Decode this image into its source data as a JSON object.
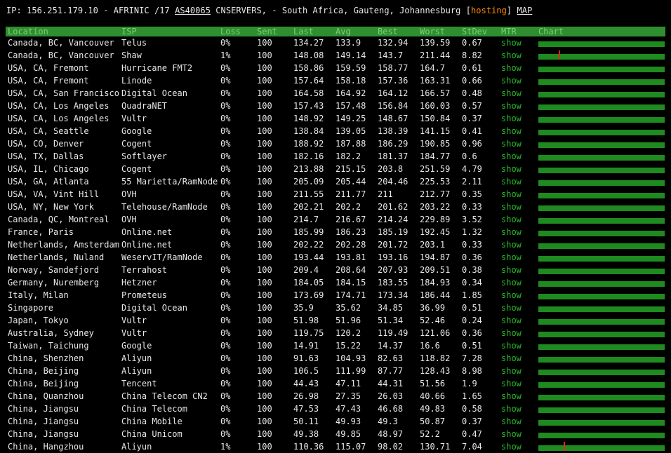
{
  "header": {
    "ip_prefix": "IP: 156.251.179.10 - AFRINIC /17 ",
    "asn": "AS40065",
    "location_text": " CNSERVERS, - South Africa, Gauteng, Johannesburg [",
    "hosting": "hosting",
    "close_bracket": "] ",
    "map": "MAP"
  },
  "columns": {
    "location": "Location",
    "isp": "ISP",
    "loss": "Loss",
    "sent": "Sent",
    "last": "Last",
    "avg": "Avg",
    "best": "Best",
    "worst": "Worst",
    "stdev": "StDev",
    "mtr": "MTR",
    "chart": "Chart"
  },
  "colors": {
    "header_bar": "#2f8f2f",
    "chart_fill": "#1f8a1f",
    "spike": "#ff2020",
    "link": "#2db82d",
    "hosting": "#ff8c00"
  },
  "rows": [
    {
      "location": "Canada, BC, Vancouver",
      "isp": "Telus",
      "loss": "0%",
      "sent": "100",
      "last": "134.27",
      "avg": "133.9",
      "best": "132.94",
      "worst": "139.59",
      "stdev": "0.67",
      "mtr": "show"
    },
    {
      "location": "Canada, BC, Vancouver",
      "isp": "Shaw",
      "loss": "1%",
      "sent": "100",
      "last": "148.08",
      "avg": "149.14",
      "best": "143.7",
      "worst": "211.44",
      "stdev": "8.82",
      "mtr": "show",
      "spike": 0.16
    },
    {
      "location": "USA, CA, Fremont",
      "isp": "Hurricane FMT2",
      "loss": "0%",
      "sent": "100",
      "last": "158.86",
      "avg": "159.59",
      "best": "158.77",
      "worst": "164.7",
      "stdev": "0.61",
      "mtr": "show"
    },
    {
      "location": "USA, CA, Fremont",
      "isp": "Linode",
      "loss": "0%",
      "sent": "100",
      "last": "157.64",
      "avg": "158.18",
      "best": "157.36",
      "worst": "163.31",
      "stdev": "0.66",
      "mtr": "show"
    },
    {
      "location": "USA, CA, San Francisco",
      "isp": "Digital Ocean",
      "loss": "0%",
      "sent": "100",
      "last": "164.58",
      "avg": "164.92",
      "best": "164.12",
      "worst": "166.57",
      "stdev": "0.48",
      "mtr": "show"
    },
    {
      "location": "USA, CA, Los Angeles",
      "isp": "QuadraNET",
      "loss": "0%",
      "sent": "100",
      "last": "157.43",
      "avg": "157.48",
      "best": "156.84",
      "worst": "160.03",
      "stdev": "0.57",
      "mtr": "show"
    },
    {
      "location": "USA, CA, Los Angeles",
      "isp": "Vultr",
      "loss": "0%",
      "sent": "100",
      "last": "148.92",
      "avg": "149.25",
      "best": "148.67",
      "worst": "150.84",
      "stdev": "0.37",
      "mtr": "show"
    },
    {
      "location": "USA, CA, Seattle",
      "isp": "Google",
      "loss": "0%",
      "sent": "100",
      "last": "138.84",
      "avg": "139.05",
      "best": "138.39",
      "worst": "141.15",
      "stdev": "0.41",
      "mtr": "show"
    },
    {
      "location": "USA, CO, Denver",
      "isp": "Cogent",
      "loss": "0%",
      "sent": "100",
      "last": "188.92",
      "avg": "187.88",
      "best": "186.29",
      "worst": "190.85",
      "stdev": "0.96",
      "mtr": "show"
    },
    {
      "location": "USA, TX, Dallas",
      "isp": "Softlayer",
      "loss": "0%",
      "sent": "100",
      "last": "182.16",
      "avg": "182.2",
      "best": "181.37",
      "worst": "184.77",
      "stdev": "0.6",
      "mtr": "show"
    },
    {
      "location": "USA, IL, Chicago",
      "isp": "Cogent",
      "loss": "0%",
      "sent": "100",
      "last": "213.88",
      "avg": "215.15",
      "best": "203.8",
      "worst": "251.59",
      "stdev": "4.79",
      "mtr": "show"
    },
    {
      "location": "USA, GA, Atlanta",
      "isp": "55 Marietta/RamNode",
      "loss": "0%",
      "sent": "100",
      "last": "205.09",
      "avg": "205.44",
      "best": "204.46",
      "worst": "225.53",
      "stdev": "2.11",
      "mtr": "show"
    },
    {
      "location": "USA, VA, Vint Hill",
      "isp": "OVH",
      "loss": "0%",
      "sent": "100",
      "last": "211.55",
      "avg": "211.77",
      "best": "211",
      "worst": "212.77",
      "stdev": "0.35",
      "mtr": "show"
    },
    {
      "location": "USA, NY, New York",
      "isp": "Telehouse/RamNode",
      "loss": "0%",
      "sent": "100",
      "last": "202.21",
      "avg": "202.2",
      "best": "201.62",
      "worst": "203.22",
      "stdev": "0.33",
      "mtr": "show"
    },
    {
      "location": "Canada, QC, Montreal",
      "isp": "OVH",
      "loss": "0%",
      "sent": "100",
      "last": "214.7",
      "avg": "216.67",
      "best": "214.24",
      "worst": "229.89",
      "stdev": "3.52",
      "mtr": "show"
    },
    {
      "location": "France, Paris",
      "isp": "Online.net",
      "loss": "0%",
      "sent": "100",
      "last": "185.99",
      "avg": "186.23",
      "best": "185.19",
      "worst": "192.45",
      "stdev": "1.32",
      "mtr": "show"
    },
    {
      "location": "Netherlands, Amsterdam",
      "isp": "Online.net",
      "loss": "0%",
      "sent": "100",
      "last": "202.22",
      "avg": "202.28",
      "best": "201.72",
      "worst": "203.1",
      "stdev": "0.33",
      "mtr": "show"
    },
    {
      "location": "Netherlands, Nuland",
      "isp": "WeservIT/RamNode",
      "loss": "0%",
      "sent": "100",
      "last": "193.44",
      "avg": "193.81",
      "best": "193.16",
      "worst": "194.87",
      "stdev": "0.36",
      "mtr": "show"
    },
    {
      "location": "Norway, Sandefjord",
      "isp": "Terrahost",
      "loss": "0%",
      "sent": "100",
      "last": "209.4",
      "avg": "208.64",
      "best": "207.93",
      "worst": "209.51",
      "stdev": "0.38",
      "mtr": "show"
    },
    {
      "location": "Germany, Nuremberg",
      "isp": "Hetzner",
      "loss": "0%",
      "sent": "100",
      "last": "184.05",
      "avg": "184.15",
      "best": "183.55",
      "worst": "184.93",
      "stdev": "0.34",
      "mtr": "show"
    },
    {
      "location": "Italy, Milan",
      "isp": "Prometeus",
      "loss": "0%",
      "sent": "100",
      "last": "173.69",
      "avg": "174.71",
      "best": "173.34",
      "worst": "186.44",
      "stdev": "1.85",
      "mtr": "show"
    },
    {
      "location": "Singapore",
      "isp": "Digital Ocean",
      "loss": "0%",
      "sent": "100",
      "last": "35.9",
      "avg": "35.62",
      "best": "34.85",
      "worst": "36.99",
      "stdev": "0.51",
      "mtr": "show"
    },
    {
      "location": "Japan, Tokyo",
      "isp": "Vultr",
      "loss": "0%",
      "sent": "100",
      "last": "51.98",
      "avg": "51.96",
      "best": "51.34",
      "worst": "52.46",
      "stdev": "0.24",
      "mtr": "show"
    },
    {
      "location": "Australia, Sydney",
      "isp": "Vultr",
      "loss": "0%",
      "sent": "100",
      "last": "119.75",
      "avg": "120.2",
      "best": "119.49",
      "worst": "121.06",
      "stdev": "0.36",
      "mtr": "show"
    },
    {
      "location": "Taiwan, Taichung",
      "isp": "Google",
      "loss": "0%",
      "sent": "100",
      "last": "14.91",
      "avg": "15.22",
      "best": "14.37",
      "worst": "16.6",
      "stdev": "0.51",
      "mtr": "show"
    },
    {
      "location": "China, Shenzhen",
      "isp": "Aliyun",
      "loss": "0%",
      "sent": "100",
      "last": "91.63",
      "avg": "104.93",
      "best": "82.63",
      "worst": "118.82",
      "stdev": "7.28",
      "mtr": "show"
    },
    {
      "location": "China, Beijing",
      "isp": "Aliyun",
      "loss": "0%",
      "sent": "100",
      "last": "106.5",
      "avg": "111.99",
      "best": "87.77",
      "worst": "128.43",
      "stdev": "8.98",
      "mtr": "show"
    },
    {
      "location": "China, Beijing",
      "isp": "Tencent",
      "loss": "0%",
      "sent": "100",
      "last": "44.43",
      "avg": "47.11",
      "best": "44.31",
      "worst": "51.56",
      "stdev": "1.9",
      "mtr": "show"
    },
    {
      "location": "China, Quanzhou",
      "isp": "China Telecom CN2",
      "loss": "0%",
      "sent": "100",
      "last": "26.98",
      "avg": "27.35",
      "best": "26.03",
      "worst": "40.66",
      "stdev": "1.65",
      "mtr": "show"
    },
    {
      "location": "China, Jiangsu",
      "isp": "China Telecom",
      "loss": "0%",
      "sent": "100",
      "last": "47.53",
      "avg": "47.43",
      "best": "46.68",
      "worst": "49.83",
      "stdev": "0.58",
      "mtr": "show"
    },
    {
      "location": "China, Jiangsu",
      "isp": "China Mobile",
      "loss": "0%",
      "sent": "100",
      "last": "50.11",
      "avg": "49.93",
      "best": "49.3",
      "worst": "50.87",
      "stdev": "0.37",
      "mtr": "show"
    },
    {
      "location": "China, Jiangsu",
      "isp": "China Unicom",
      "loss": "0%",
      "sent": "100",
      "last": "49.38",
      "avg": "49.85",
      "best": "48.97",
      "worst": "52.2",
      "stdev": "0.47",
      "mtr": "show"
    },
    {
      "location": "China, Hangzhou",
      "isp": "Aliyun",
      "loss": "1%",
      "sent": "100",
      "last": "110.36",
      "avg": "115.07",
      "best": "98.02",
      "worst": "130.71",
      "stdev": "7.04",
      "mtr": "show",
      "spike": 0.2
    }
  ]
}
